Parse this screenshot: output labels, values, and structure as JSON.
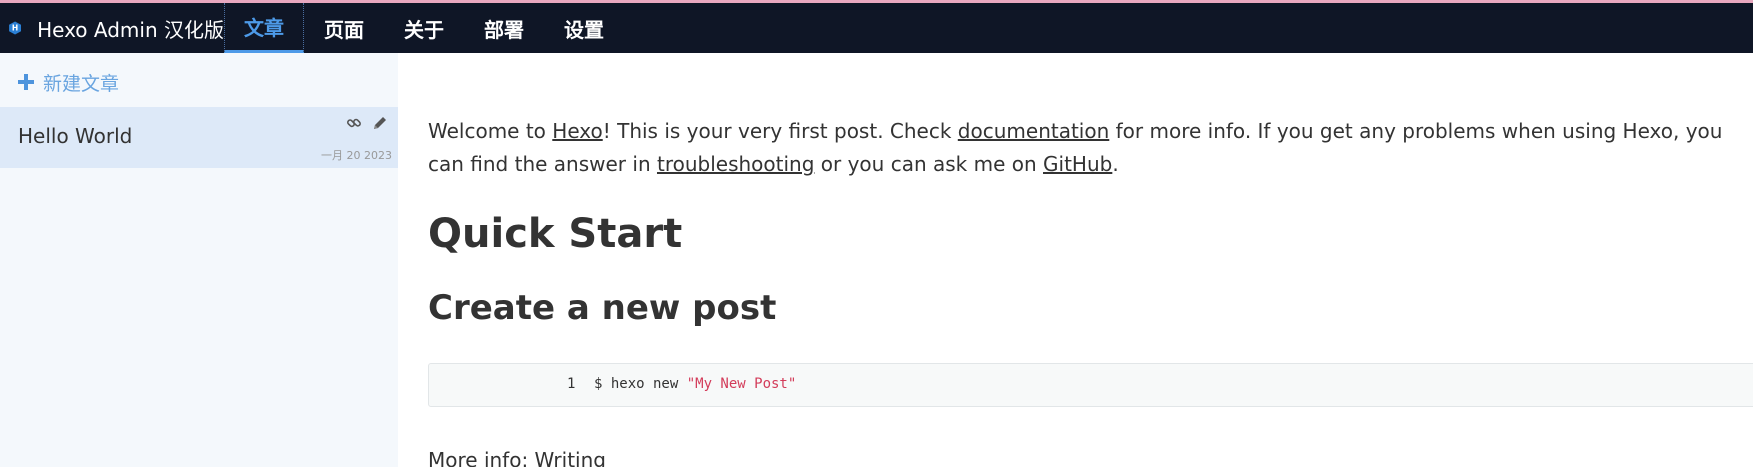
{
  "app": {
    "title": "Hexo Admin 汉化版",
    "logo_letter": "H",
    "accent_color": "#4d9ae8",
    "nav_bg": "#0f1626"
  },
  "nav": {
    "items": [
      {
        "label": "文章",
        "active": true
      },
      {
        "label": "页面"
      },
      {
        "label": "关于"
      },
      {
        "label": "部署"
      },
      {
        "label": "设置"
      }
    ]
  },
  "sidebar": {
    "new_post_label": "新建文章",
    "posts": [
      {
        "title": "Hello World",
        "date": "一月 20 2023",
        "icons": [
          "link-icon",
          "pencil-icon"
        ]
      }
    ]
  },
  "content": {
    "intro": {
      "t1": "Welcome to ",
      "link1": "Hexo",
      "t2": "! This is your very first post. Check ",
      "link2": "documentation",
      "t3": " for more info. If you get any problems when using Hexo, you can find the answer in ",
      "link3": "troubleshooting",
      "t4": " or you can ask me on ",
      "link4": "GitHub",
      "t5": "."
    },
    "heading1": "Quick Start",
    "heading2": "Create a new post",
    "code": {
      "line_number": "1",
      "command": "$ hexo new ",
      "argument": "\"My New Post\""
    },
    "more_info": {
      "label": "More info: ",
      "link": "Writing"
    }
  }
}
